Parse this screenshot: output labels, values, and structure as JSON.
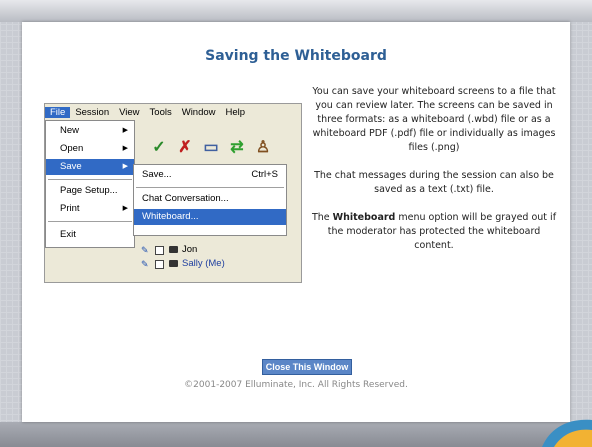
{
  "panel": {
    "title": "Saving the Whiteboard",
    "paragraphs": [
      "You can save your whiteboard screens to a file that you can review later. The screens can be saved in three formats: as a whiteboard (.wbd) file or as a whiteboard PDF (.pdf) file or individually as images files (.png)",
      "The chat messages during the session can also be saved as a text (.txt) file."
    ],
    "note_bold": "Whiteboard",
    "note_prefix": "The ",
    "note_suffix": " menu option will be grayed out if the moderator has protected the whiteboard content.",
    "close_button": "Close This Window",
    "copyright": "©2001-2007 Elluminate, Inc. All Rights Reserved."
  },
  "screenshot": {
    "menubar": [
      "File",
      "Session",
      "View",
      "Tools",
      "Window",
      "Help"
    ],
    "file_menu": [
      "New",
      "Open",
      "Save",
      "Page Setup...",
      "Print",
      "Exit"
    ],
    "save_submenu": {
      "save": "Save...",
      "save_shortcut": "Ctrl+S",
      "chat": "Chat Conversation...",
      "whiteboard": "Whiteboard..."
    },
    "participants": [
      "Jon",
      "Sally (Me)"
    ]
  },
  "colors": {
    "title": "#2e5f95",
    "menu_highlight": "#316ac5",
    "button": "#5b86c7"
  }
}
